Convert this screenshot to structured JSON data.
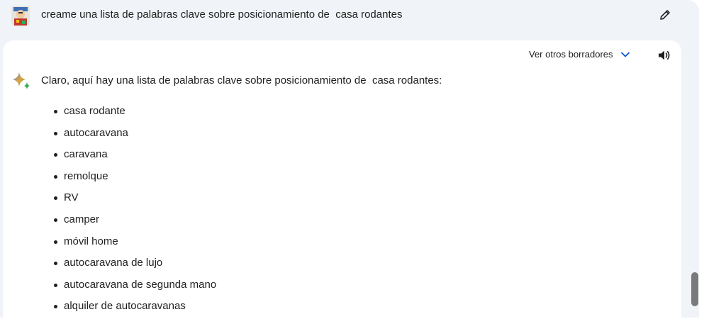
{
  "prompt": {
    "text": "creame una lista de palabras clave sobre posicionamiento de  casa rodantes",
    "avatar_icon": "user-avatar",
    "edit_icon": "pencil-icon"
  },
  "response": {
    "drafts_label": "Ver otros borradores",
    "drafts_icon": "chevron-down-icon",
    "speaker_icon": "speaker-icon",
    "model_icon": "sparkle-icon",
    "intro": "Claro, aquí hay una lista de palabras clave sobre posicionamiento de  casa rodantes:",
    "keywords": [
      "casa rodante",
      "autocaravana",
      "caravana",
      "remolque",
      "RV",
      "camper",
      "móvil home",
      "autocaravana de lujo",
      "autocaravana de segunda mano",
      "alquiler de autocaravanas"
    ]
  },
  "colors": {
    "panel_bg": "#f0f4f9",
    "card_bg": "#ffffff",
    "accent_blue": "#0b57d0",
    "text": "#1f1f1f"
  }
}
